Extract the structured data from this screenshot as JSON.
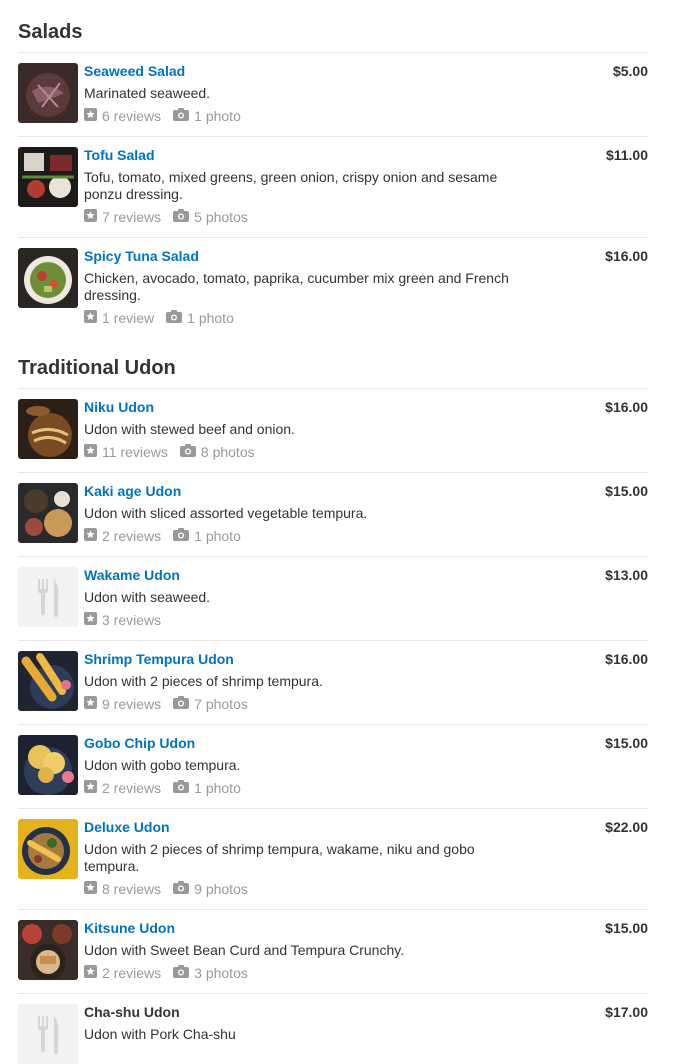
{
  "sections": [
    {
      "title": "Salads",
      "items": [
        {
          "name": "Seaweed Salad",
          "price": "$5.00",
          "desc": "Marinated seaweed.",
          "reviews": "6 reviews",
          "photos": "1 photo",
          "thumb": "seaweed-salad-photo"
        },
        {
          "name": "Tofu Salad",
          "price": "$11.00",
          "desc": "Tofu, tomato, mixed greens, green onion, crispy onion and sesame ponzu dressing.",
          "reviews": "7 reviews",
          "photos": "5 photos",
          "thumb": "tofu-salad-photo"
        },
        {
          "name": "Spicy Tuna Salad",
          "price": "$16.00",
          "desc": "Chicken, avocado, tomato, paprika, cucumber mix green and French dressing.",
          "reviews": "1 review",
          "photos": "1 photo",
          "thumb": "spicy-tuna-salad-photo"
        }
      ]
    },
    {
      "title": "Traditional Udon",
      "items": [
        {
          "name": "Niku Udon",
          "price": "$16.00",
          "desc": "Udon with stewed beef and onion.",
          "reviews": "11 reviews",
          "photos": "8 photos",
          "thumb": "niku-udon-photo"
        },
        {
          "name": "Kaki age Udon",
          "price": "$15.00",
          "desc": "Udon with sliced assorted vegetable tempura.",
          "reviews": "2 reviews",
          "photos": "1 photo",
          "thumb": "kaki-age-udon-photo"
        },
        {
          "name": "Wakame Udon",
          "price": "$13.00",
          "desc": "Udon with seaweed.",
          "reviews": "3 reviews",
          "photos": "",
          "thumb": "placeholder"
        },
        {
          "name": "Shrimp Tempura Udon",
          "price": "$16.00",
          "desc": "Udon with 2 pieces of shrimp tempura.",
          "reviews": "9 reviews",
          "photos": "7 photos",
          "thumb": "shrimp-tempura-udon-photo"
        },
        {
          "name": "Gobo Chip Udon",
          "price": "$15.00",
          "desc": "Udon with gobo tempura.",
          "reviews": "2 reviews",
          "photos": "1 photo",
          "thumb": "gobo-chip-udon-photo"
        },
        {
          "name": "Deluxe Udon",
          "price": "$22.00",
          "desc": "Udon with 2 pieces of shrimp tempura, wakame, niku and gobo tempura.",
          "reviews": "8 reviews",
          "photos": "9 photos",
          "thumb": "deluxe-udon-photo"
        },
        {
          "name": "Kitsune Udon",
          "price": "$15.00",
          "desc": "Udon with Sweet Bean Curd and Tempura Crunchy.",
          "reviews": "2 reviews",
          "photos": "3 photos",
          "thumb": "kitsune-udon-photo"
        },
        {
          "name": "Cha-shu Udon",
          "price": "$17.00",
          "desc": "Udon with Pork Cha-shu",
          "reviews": "",
          "photos": "",
          "thumb": "placeholder"
        }
      ]
    }
  ],
  "colors": {
    "link": "#0073bb",
    "muted": "#999999",
    "divider": "#e6e6e6"
  }
}
